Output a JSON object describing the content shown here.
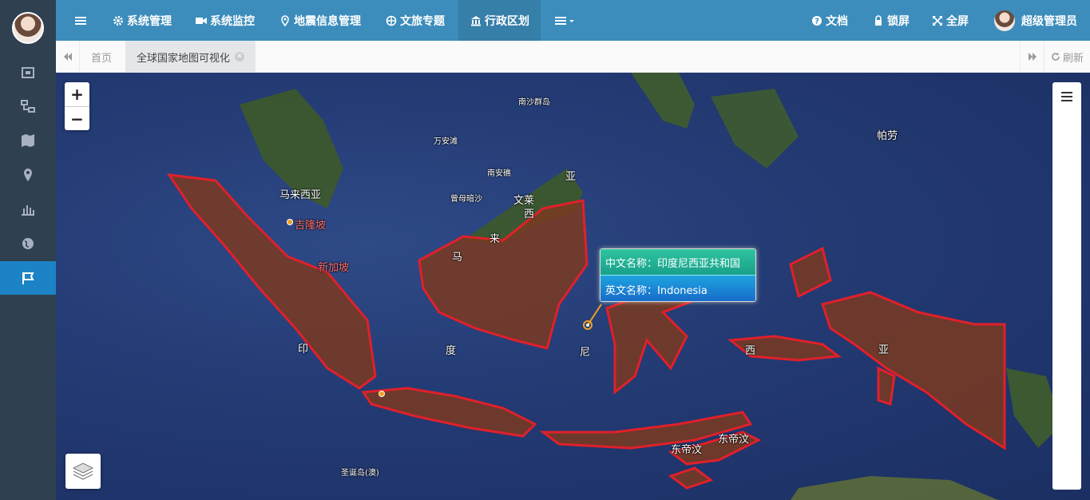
{
  "sidebar": {
    "items": [
      {
        "icon": "frame-icon"
      },
      {
        "icon": "diagram-icon"
      },
      {
        "icon": "map-icon"
      },
      {
        "icon": "location-pin-icon"
      },
      {
        "icon": "bar-chart-icon"
      },
      {
        "icon": "globe-icon"
      },
      {
        "icon": "flag-icon",
        "active": true
      }
    ]
  },
  "topbar": {
    "menu_icon": "hamburger-icon",
    "items": [
      {
        "label": "系统管理",
        "icon": "gear-icon"
      },
      {
        "label": "系统监控",
        "icon": "video-camera-icon"
      },
      {
        "label": "地震信息管理",
        "icon": "map-marker-icon"
      },
      {
        "label": "文旅专题",
        "icon": "globe-icon"
      },
      {
        "label": "行政区划",
        "icon": "bank-icon",
        "active": true
      }
    ],
    "more_icon": "list-dropdown-icon",
    "right": [
      {
        "label": "文档",
        "icon": "question-icon"
      },
      {
        "label": "锁屏",
        "icon": "lock-icon"
      },
      {
        "label": "全屏",
        "icon": "expand-icon"
      }
    ],
    "user_name": "超级管理员"
  },
  "tabs": {
    "items": [
      {
        "label": "首页"
      },
      {
        "label": "全球国家地图可视化",
        "active": true
      }
    ],
    "refresh_label": "刷新"
  },
  "map": {
    "zoom_in": "+",
    "zoom_out": "−",
    "labels": {
      "nansha": "南沙群岛",
      "wanan": "万安滩",
      "nanan": "南安礁",
      "zengmu": "曾母暗沙",
      "malaysia": "马来西亚",
      "brunei": "文莱",
      "ya1": "亚",
      "xi1": "西",
      "lai": "来",
      "ma": "马",
      "palau": "帕劳",
      "kuala": "吉隆坡",
      "singapore": "新加坡",
      "yin": "印",
      "du": "度",
      "ni": "尼",
      "xi2": "西",
      "ya2": "亚",
      "timor1": "东帝汶",
      "timor2": "东帝汶",
      "christmas": "圣诞岛(澳)"
    },
    "popup": {
      "cn_label": "中文名称：印度尼西亚共和国",
      "en_label": "英文名称：Indonesia"
    },
    "colors": {
      "highlight_fill": "#7a3a20",
      "highlight_stroke": "#e0202a",
      "land": "#3d5a2a"
    }
  }
}
